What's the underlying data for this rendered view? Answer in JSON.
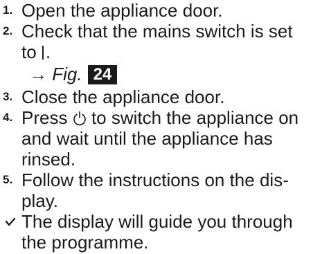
{
  "steps": [
    {
      "number": "1.",
      "lines": [
        "Open the appliance door."
      ]
    },
    {
      "number": "2.",
      "lines": [
        "Check that the mains switch is set",
        "to"
      ],
      "figure_arrow": "→",
      "figure_label": "Fig.",
      "figure_number": "24"
    },
    {
      "number": "3.",
      "lines": [
        "Close the appliance door."
      ]
    },
    {
      "number": "4.",
      "lines": [
        "Press",
        "to switch the appliance on",
        "and wait until the appliance has",
        "rinsed."
      ]
    },
    {
      "number": "5.",
      "lines": [
        "Follow the instructions on the dis-",
        "play."
      ]
    }
  ],
  "result": {
    "lines": [
      "The display will guide you through",
      "the programme."
    ]
  },
  "icons": {
    "mains_on": "mains-switch-on-icon",
    "power": "power-icon",
    "result": "check-mark-icon"
  }
}
